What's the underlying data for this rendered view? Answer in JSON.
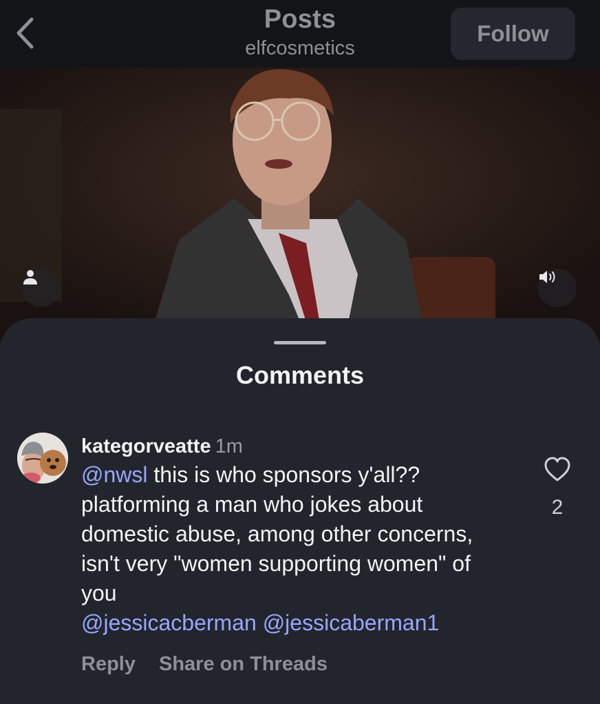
{
  "header": {
    "title": "Posts",
    "subtitle": "elfcosmetics",
    "follow_label": "Follow",
    "back_icon": "chevron-left-icon"
  },
  "video": {
    "user_tag_icon": "person-icon",
    "sound_icon": "speaker-icon"
  },
  "comments_sheet": {
    "title": "Comments",
    "comments": [
      {
        "username": "kategorveatte",
        "time": "1m",
        "mention_start": "@nwsl",
        "text": " this is who sponsors y'all?? platforming a man who jokes about domestic abuse, among other concerns, isn't very \"women supporting women\" of you",
        "mention_end_1": "@jessicacberman",
        "mention_end_2": "@jessicaberman1",
        "like_count": "2",
        "reply_label": "Reply",
        "share_label": "Share on Threads"
      }
    ]
  },
  "colors": {
    "background": "#121418",
    "sheet": "#22252c",
    "mention": "#97a7ff",
    "muted": "#8f9096"
  }
}
